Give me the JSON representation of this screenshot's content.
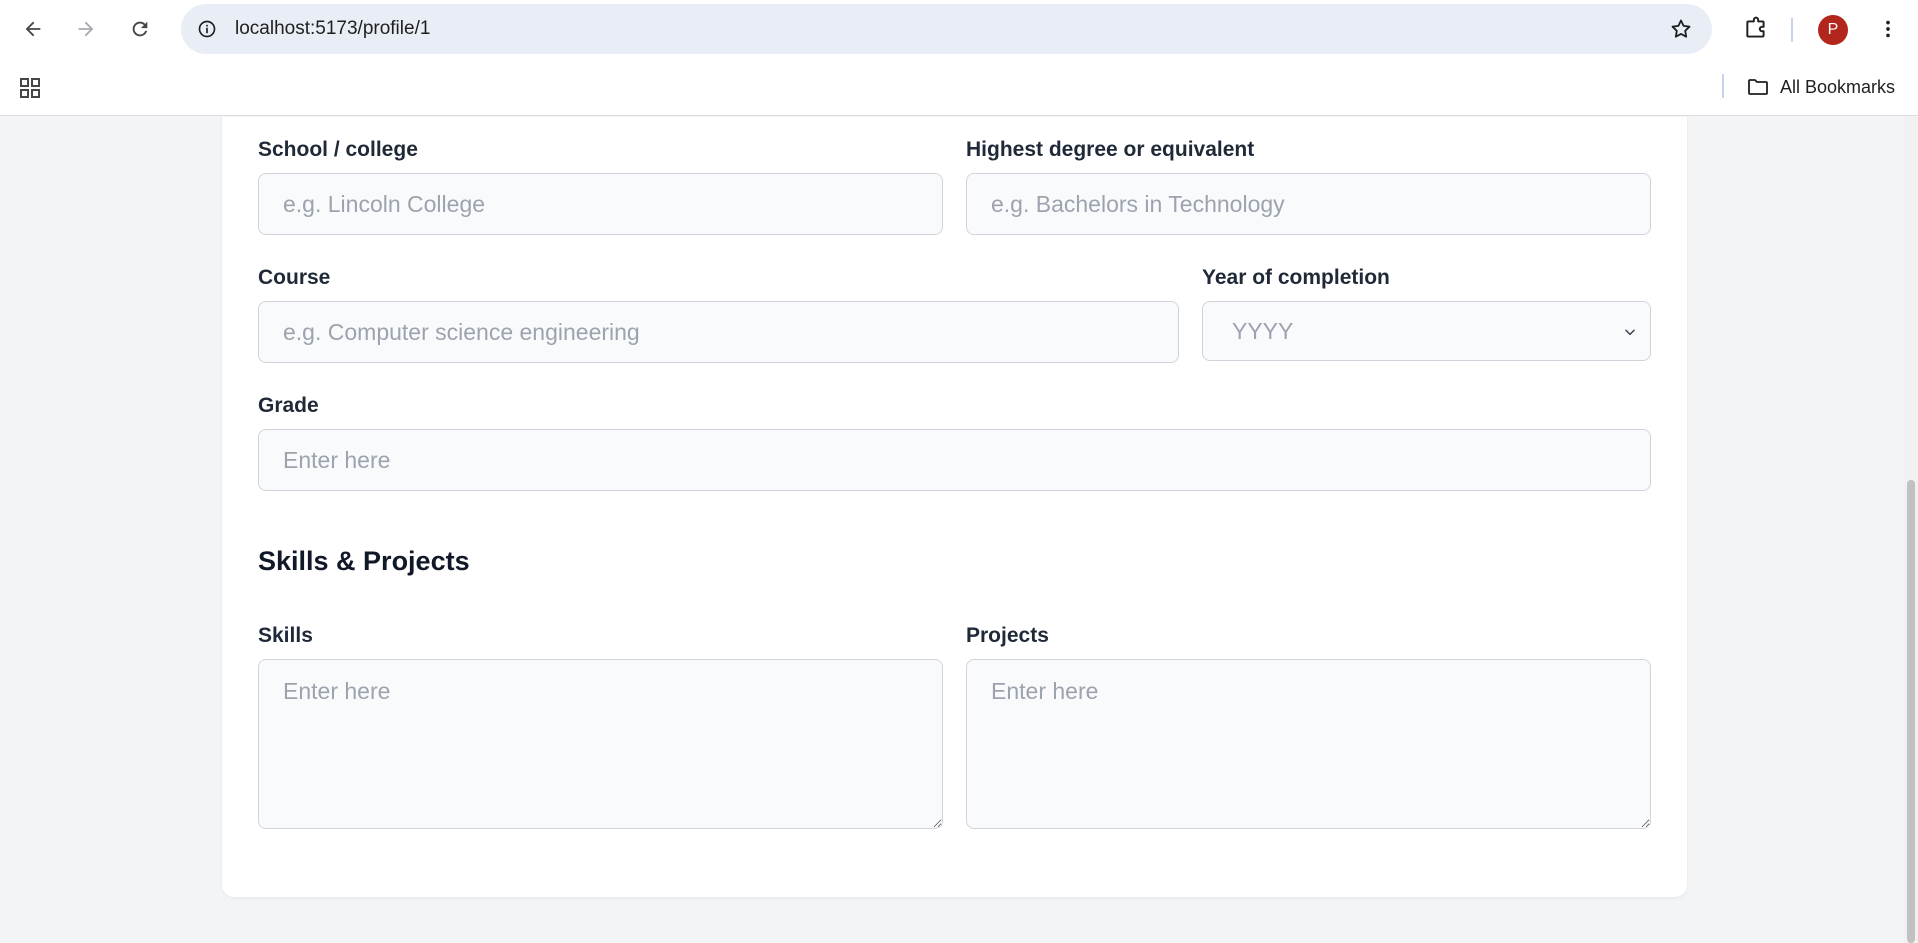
{
  "browser": {
    "url": "localhost:5173/profile/1",
    "avatar_letter": "P",
    "avatar_color": "#b3261e",
    "bookmarks_label": "All Bookmarks"
  },
  "form": {
    "school": {
      "label": "School / college",
      "placeholder": "e.g. Lincoln College"
    },
    "degree": {
      "label": "Highest degree or equivalent",
      "placeholder": "e.g. Bachelors in Technology"
    },
    "course": {
      "label": "Course",
      "placeholder": "e.g. Computer science engineering"
    },
    "year": {
      "label": "Year of completion",
      "selected": "YYYY"
    },
    "grade": {
      "label": "Grade",
      "placeholder": "Enter here"
    }
  },
  "skills_section": {
    "heading": "Skills & Projects",
    "skills": {
      "label": "Skills",
      "placeholder": "Enter here"
    },
    "projects": {
      "label": "Projects",
      "placeholder": "Enter here"
    }
  }
}
